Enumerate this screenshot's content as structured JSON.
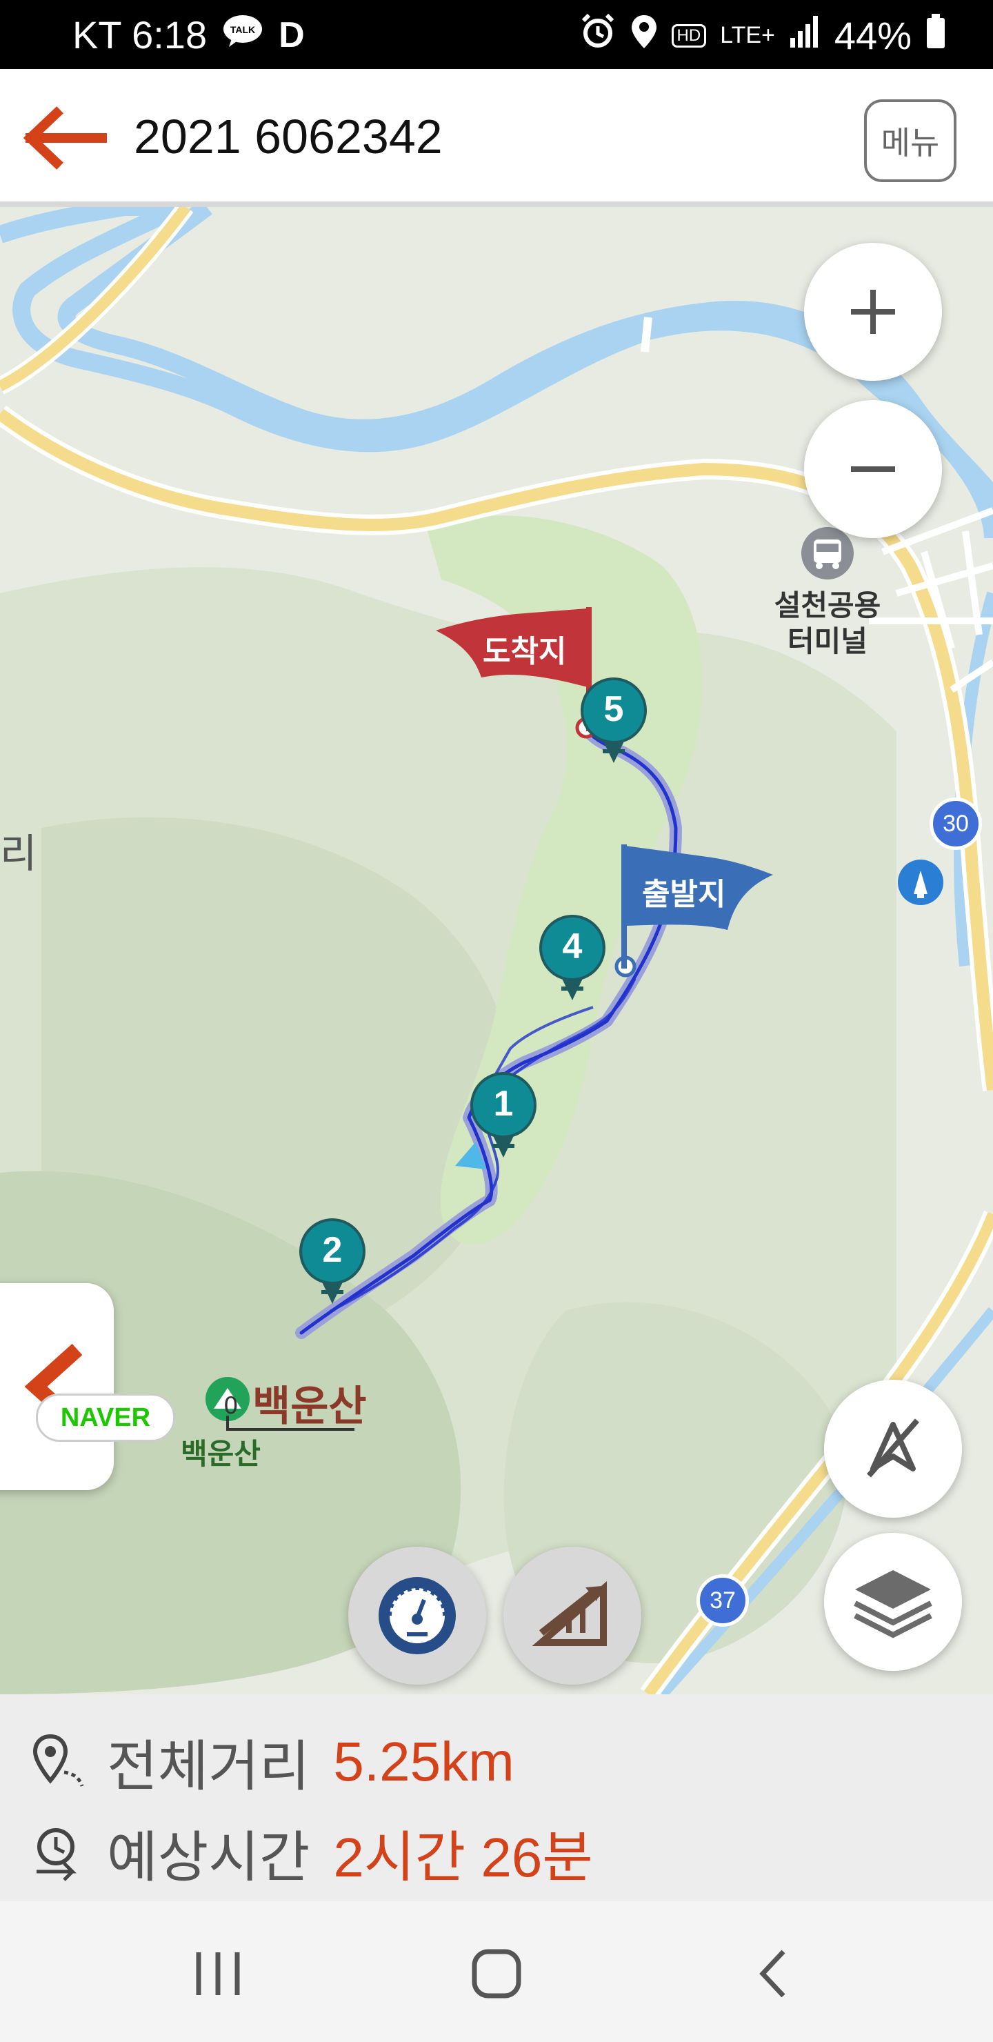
{
  "status_bar": {
    "carrier_time": "KT 6:18",
    "talk_badge": "TALK",
    "d_badge": "D",
    "hd_badge": "HD",
    "network": "LTE+",
    "battery": "44%"
  },
  "app_bar": {
    "title": "2021 6062342",
    "menu_label": "메뉴"
  },
  "map": {
    "flag_end": "도착지",
    "flag_start": "출발지",
    "waypoints": [
      "1",
      "2",
      "4",
      "5"
    ],
    "terminal_label_1": "설천공용",
    "terminal_label_2": "터미널",
    "mountain_label_big": "백운산",
    "mountain_label_small": "백운산",
    "road_30": "30",
    "road_37": "37",
    "left_edge_label": "리",
    "naver_logo": "NAVER",
    "scale_zero": "0"
  },
  "info": {
    "distance_label": "전체거리",
    "distance_value": "5.25km",
    "time_label": "예상시간",
    "time_value": "2시간 26분"
  },
  "colors": {
    "accent": "#d4421a",
    "route": "#2233cc",
    "waypoint": "#0e8b94",
    "flag_start": "#3a6fb8",
    "flag_end": "#c0343a"
  }
}
